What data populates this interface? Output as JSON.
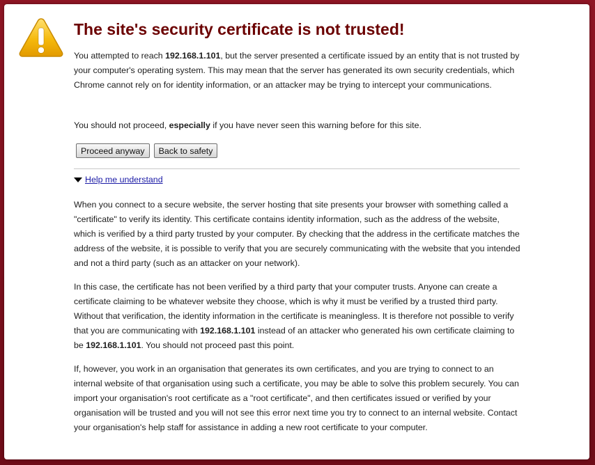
{
  "page": {
    "title": "The site's security certificate is not trusted!",
    "host": "192.168.1.101"
  },
  "intro": {
    "p1_a": "You attempted to reach ",
    "p1_b": ", but the server presented a certificate issued by an entity that is not trusted by your computer's operating system. This may mean that the server has generated its own security credentials, which Chrome cannot rely on for identity information, or an attacker may be trying to intercept your communications.",
    "p2_a": "You should not proceed, ",
    "p2_bold": "especially",
    "p2_b": " if you have never seen this warning before for this site."
  },
  "buttons": {
    "proceed": "Proceed anyway",
    "back": "Back to safety"
  },
  "help": {
    "link": "Help me understand",
    "p3": "When you connect to a secure website, the server hosting that site presents your browser with something called a \"certificate\" to verify its identity. This certificate contains identity information, such as the address of the website, which is verified by a third party trusted by your computer. By checking that the address in the certificate matches the address of the website, it is possible to verify that you are securely communicating with the website that you intended and not a third party (such as an attacker on your network).",
    "p4_a": "In this case, the certificate has not been verified by a third party that your computer trusts. Anyone can create a certificate claiming to be whatever website they choose, which is why it must be verified by a trusted third party. Without that verification, the identity information in the certificate is meaningless. It is therefore not possible to verify that you are communicating with ",
    "p4_b": " instead of an attacker who generated his own certificate claiming to be ",
    "p4_c": ". You should not proceed past this point.",
    "p5": "If, however, you work in an organisation that generates its own certificates, and you are trying to connect to an internal website of that organisation using such a certificate, you may be able to solve this problem securely. You can import your organisation's root certificate as a \"root certificate\", and then certificates issued or verified by your organisation will be trusted and you will not see this error next time you try to connect to an internal website. Contact your organisation's help staff for assistance in adding a new root certificate to your computer."
  },
  "icons": {
    "warning": "warning-triangle-icon",
    "disclosure": "triangle-down-icon"
  },
  "colors": {
    "background": "#7a0e1c",
    "title": "#6b0000",
    "link": "#1a1aa6",
    "warning_fill": "#f5b90c"
  }
}
